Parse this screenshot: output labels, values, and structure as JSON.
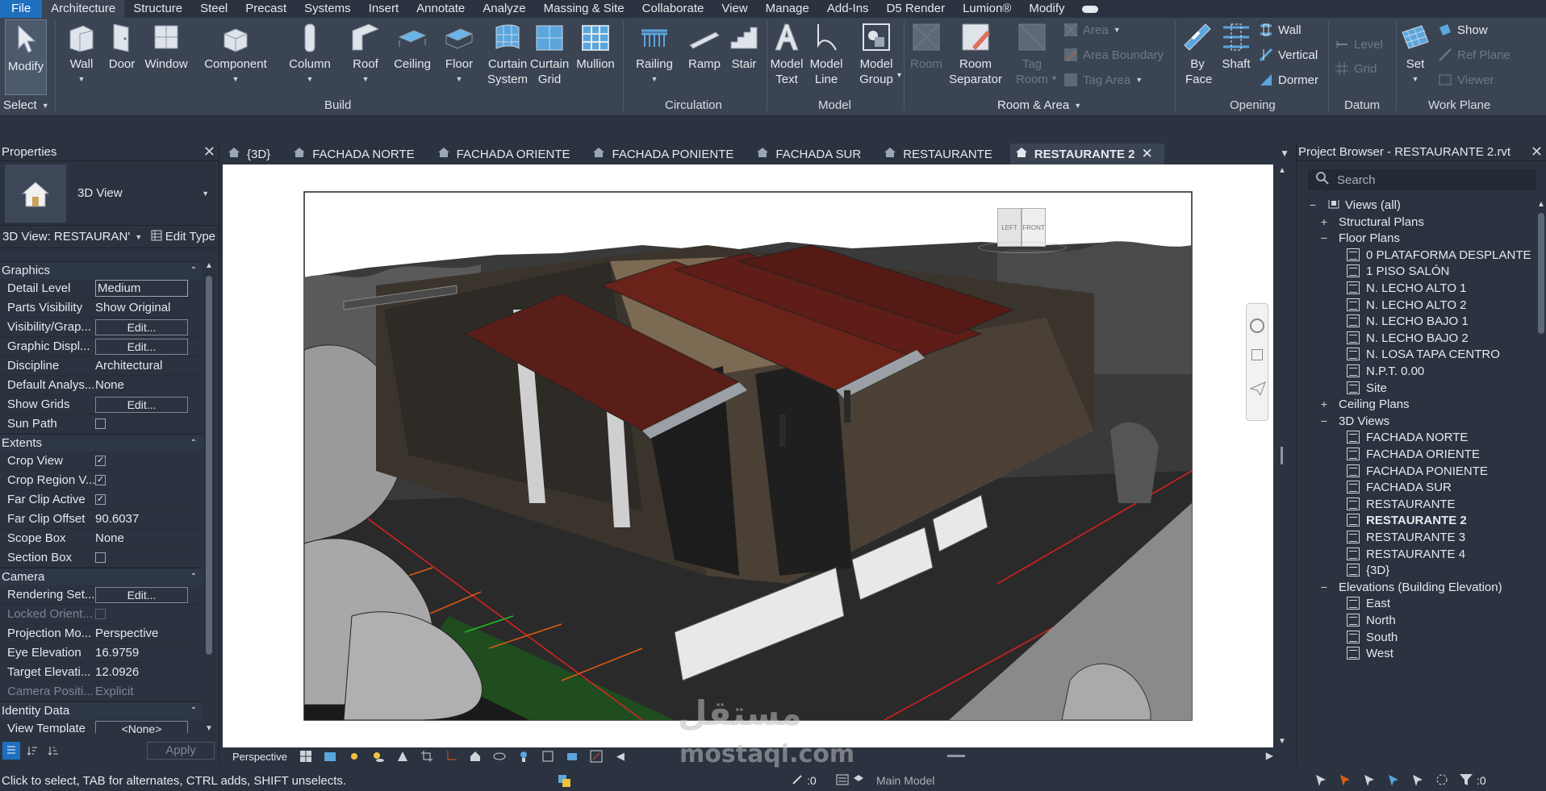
{
  "menubar": {
    "tabs": [
      "File",
      "Architecture",
      "Structure",
      "Steel",
      "Precast",
      "Systems",
      "Insert",
      "Annotate",
      "Analyze",
      "Massing & Site",
      "Collaborate",
      "View",
      "Manage",
      "Add-Ins",
      "D5 Render",
      "Lumion®",
      "Modify"
    ],
    "active": "Architecture"
  },
  "ribbon": {
    "select": {
      "modify": "Modify",
      "select_label": "Select"
    },
    "build": {
      "label": "Build",
      "wall": "Wall",
      "door": "Door",
      "window": "Window",
      "component": "Component",
      "column": "Column",
      "roof": "Roof",
      "ceiling": "Ceiling",
      "floor": "Floor",
      "curtain_system": "Curtain System",
      "curtain_grid": "Curtain Grid",
      "mullion": "Mullion"
    },
    "circulation": {
      "label": "Circulation",
      "railing": "Railing",
      "ramp": "Ramp",
      "stair": "Stair"
    },
    "model": {
      "label": "Model",
      "model_text": "Model Text",
      "model_line": "Model Line",
      "model_group": "Model Group"
    },
    "room_area": {
      "label": "Room & Area",
      "room": "Room",
      "room_separator": "Room Separator",
      "tag_room": "Tag Room",
      "area": "Area",
      "area_boundary": "Area  Boundary",
      "tag_area": "Tag  Area"
    },
    "opening": {
      "label": "Opening",
      "by_face": "By Face",
      "shaft": "Shaft",
      "wall": "Wall",
      "vertical": "Vertical",
      "dormer": "Dormer"
    },
    "datum": {
      "label": "Datum",
      "level": "Level",
      "grid": "Grid"
    },
    "work_plane": {
      "label": "Work Plane",
      "set": "Set",
      "show": "Show",
      "ref_plane": "Ref  Plane",
      "viewer": "Viewer"
    }
  },
  "properties": {
    "title": "Properties",
    "type_name": "3D View",
    "instance": "3D View: RESTAURAN'",
    "edit_type": "Edit Type",
    "groups": [
      {
        "name": "Graphics",
        "rows": [
          {
            "name": "Detail Level",
            "kind": "input",
            "value": "Medium"
          },
          {
            "name": "Parts Visibility",
            "kind": "text",
            "value": "Show Original"
          },
          {
            "name": "Visibility/Grap...",
            "kind": "button",
            "value": "Edit..."
          },
          {
            "name": "Graphic Displ...",
            "kind": "button",
            "value": "Edit..."
          },
          {
            "name": "Discipline",
            "kind": "text",
            "value": "Architectural"
          },
          {
            "name": "Default Analys...",
            "kind": "text",
            "value": "None"
          },
          {
            "name": "Show Grids",
            "kind": "button",
            "value": "Edit..."
          },
          {
            "name": "Sun Path",
            "kind": "check",
            "value": ""
          }
        ]
      },
      {
        "name": "Extents",
        "rows": [
          {
            "name": "Crop View",
            "kind": "check",
            "value": "✓"
          },
          {
            "name": "Crop Region V...",
            "kind": "check",
            "value": "✓"
          },
          {
            "name": "Far Clip Active",
            "kind": "check",
            "value": "✓"
          },
          {
            "name": "Far Clip Offset",
            "kind": "text",
            "value": "90.6037"
          },
          {
            "name": "Scope Box",
            "kind": "text",
            "value": "None"
          },
          {
            "name": "Section Box",
            "kind": "check",
            "value": ""
          }
        ]
      },
      {
        "name": "Camera",
        "rows": [
          {
            "name": "Rendering Set...",
            "kind": "button",
            "value": "Edit..."
          },
          {
            "name": "Locked Orient...",
            "kind": "check",
            "value": "",
            "dim": true
          },
          {
            "name": "Projection Mo...",
            "kind": "text",
            "value": "Perspective"
          },
          {
            "name": "Eye Elevation",
            "kind": "text",
            "value": "16.9759"
          },
          {
            "name": "Target Elevati...",
            "kind": "text",
            "value": "12.0926"
          },
          {
            "name": "Camera Positi...",
            "kind": "text",
            "value": "Explicit",
            "dim": true
          }
        ]
      },
      {
        "name": "Identity Data",
        "rows": [
          {
            "name": "View Template",
            "kind": "button",
            "value": "<None>"
          }
        ]
      }
    ],
    "apply": "Apply"
  },
  "view_tabs": [
    {
      "label": "{3D}"
    },
    {
      "label": "FACHADA NORTE"
    },
    {
      "label": "FACHADA ORIENTE"
    },
    {
      "label": "FACHADA PONIENTE"
    },
    {
      "label": "FACHADA SUR"
    },
    {
      "label": "RESTAURANTE"
    },
    {
      "label": "RESTAURANTE 2",
      "active": true
    }
  ],
  "view_cube": {
    "left": "LEFT",
    "front": "FRONT"
  },
  "view_bar": {
    "mode": "Perspective"
  },
  "browser": {
    "title": "Project Browser - RESTAURANTE 2.rvt",
    "search_placeholder": "Search",
    "tree": [
      {
        "label": "Views (all)",
        "level": 0,
        "toggle": "−",
        "icon": true
      },
      {
        "label": "Structural Plans",
        "level": 1,
        "toggle": "+"
      },
      {
        "label": "Floor Plans",
        "level": 1,
        "toggle": "−"
      },
      {
        "label": "0 PLATAFORMA DESPLANTE",
        "level": 2
      },
      {
        "label": "1 PISO SALÓN",
        "level": 2
      },
      {
        "label": "N. LECHO ALTO 1",
        "level": 2
      },
      {
        "label": "N. LECHO ALTO 2",
        "level": 2
      },
      {
        "label": "N. LECHO BAJO 1",
        "level": 2
      },
      {
        "label": "N. LECHO BAJO 2",
        "level": 2
      },
      {
        "label": "N. LOSA TAPA CENTRO",
        "level": 2
      },
      {
        "label": "N.P.T. 0.00",
        "level": 2
      },
      {
        "label": "Site",
        "level": 2
      },
      {
        "label": "Ceiling Plans",
        "level": 1,
        "toggle": "+"
      },
      {
        "label": "3D Views",
        "level": 1,
        "toggle": "−"
      },
      {
        "label": "FACHADA NORTE",
        "level": 2
      },
      {
        "label": "FACHADA ORIENTE",
        "level": 2
      },
      {
        "label": "FACHADA PONIENTE",
        "level": 2
      },
      {
        "label": "FACHADA SUR",
        "level": 2
      },
      {
        "label": "RESTAURANTE",
        "level": 2
      },
      {
        "label": "RESTAURANTE 2",
        "level": 2,
        "selected": true
      },
      {
        "label": "RESTAURANTE 3",
        "level": 2
      },
      {
        "label": "RESTAURANTE 4",
        "level": 2
      },
      {
        "label": "{3D}",
        "level": 2
      },
      {
        "label": "Elevations (Building Elevation)",
        "level": 1,
        "toggle": "−"
      },
      {
        "label": "East",
        "level": 2
      },
      {
        "label": "North",
        "level": 2
      },
      {
        "label": "South",
        "level": 2
      },
      {
        "label": "West",
        "level": 2
      }
    ]
  },
  "status": {
    "text": "Click to select, TAB for alternates, CTRL adds, SHIFT unselects.",
    "worksets": ":0",
    "model": "Main Model",
    "filter": ":0"
  },
  "watermark": {
    "arabic": "مستقل",
    "latin": "mostaql.com"
  }
}
